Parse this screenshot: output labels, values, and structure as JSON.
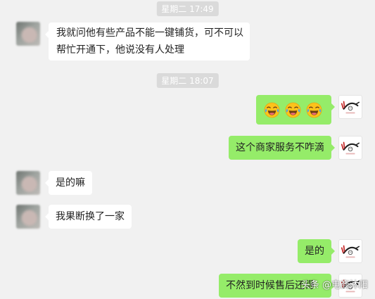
{
  "chat": {
    "timestamps": [
      "星期二 17:49",
      "星期二 18:07"
    ],
    "messages": [
      {
        "side": "left",
        "lines": [
          "我就问他有些产品不能一键铺货，可不可以",
          "帮忙开通下，他说没有人处理"
        ]
      },
      {
        "side": "right",
        "emoji": [
          "crying-laughing-emoji",
          "crying-laughing-emoji",
          "crying-laughing-emoji"
        ]
      },
      {
        "side": "right",
        "text": "这个商家服务不咋滴"
      },
      {
        "side": "left",
        "text": "是的嘛"
      },
      {
        "side": "left",
        "text": "我果断换了一家"
      },
      {
        "side": "right",
        "text": "是的"
      },
      {
        "side": "right",
        "text": "不然到时候售后还得"
      }
    ]
  },
  "watermark": "头条 @电商沐阳",
  "colors": {
    "background": "#f1f1f1",
    "bubble_self": "#95ec69",
    "bubble_other": "#ffffff",
    "timestamp_bg": "#dadada"
  }
}
